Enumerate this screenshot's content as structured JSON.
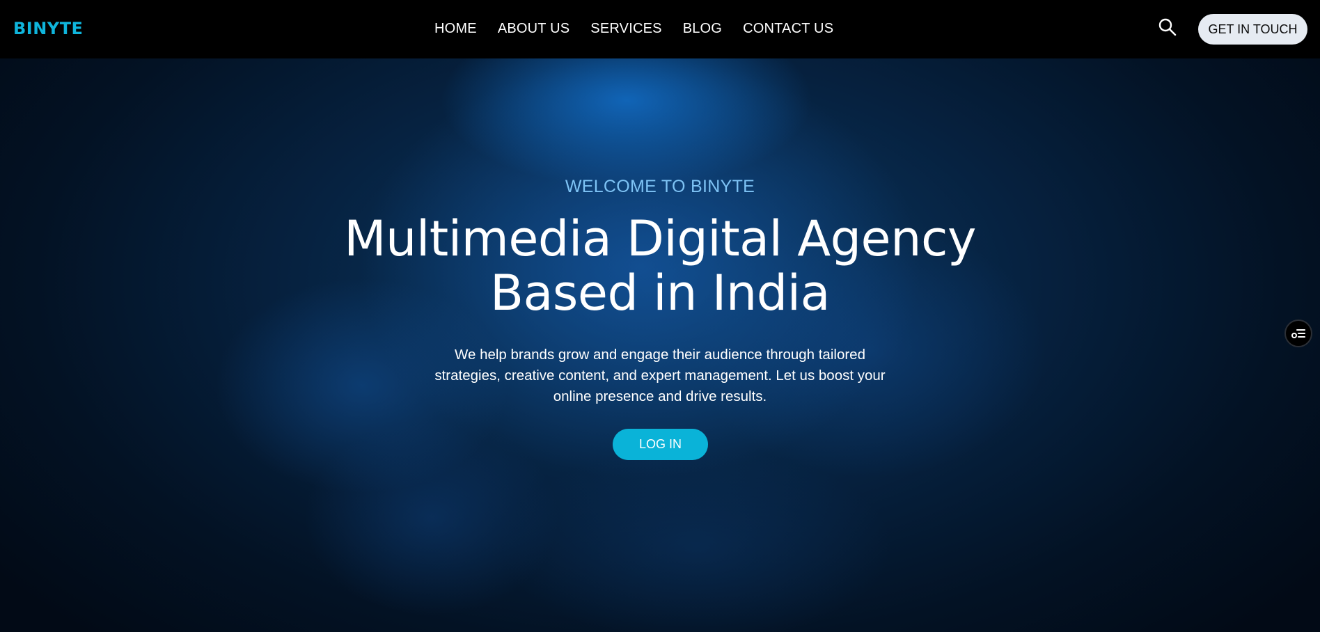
{
  "brand": {
    "name": "BINYTE",
    "color": "#0fb5dc"
  },
  "nav": {
    "items": [
      {
        "label": "HOME"
      },
      {
        "label": "ABOUT US"
      },
      {
        "label": "SERVICES"
      },
      {
        "label": "BLOG"
      },
      {
        "label": "CONTACT US"
      }
    ],
    "search_icon": "search-icon",
    "cta_label": "GET IN TOUCH"
  },
  "hero": {
    "eyebrow": "WELCOME TO BINYTE",
    "headline_line1": "Multimedia Digital Agency",
    "headline_line2": "Based in India",
    "description": "We help brands grow and engage their audience through tailored strategies, creative content, and expert management. Let us boost your online presence and drive results.",
    "button_label": "LOG IN",
    "accent_color": "#0ab3d8",
    "eyebrow_color": "#7ec3f5"
  },
  "floating_widget": {
    "icon": "settings-list-icon"
  }
}
